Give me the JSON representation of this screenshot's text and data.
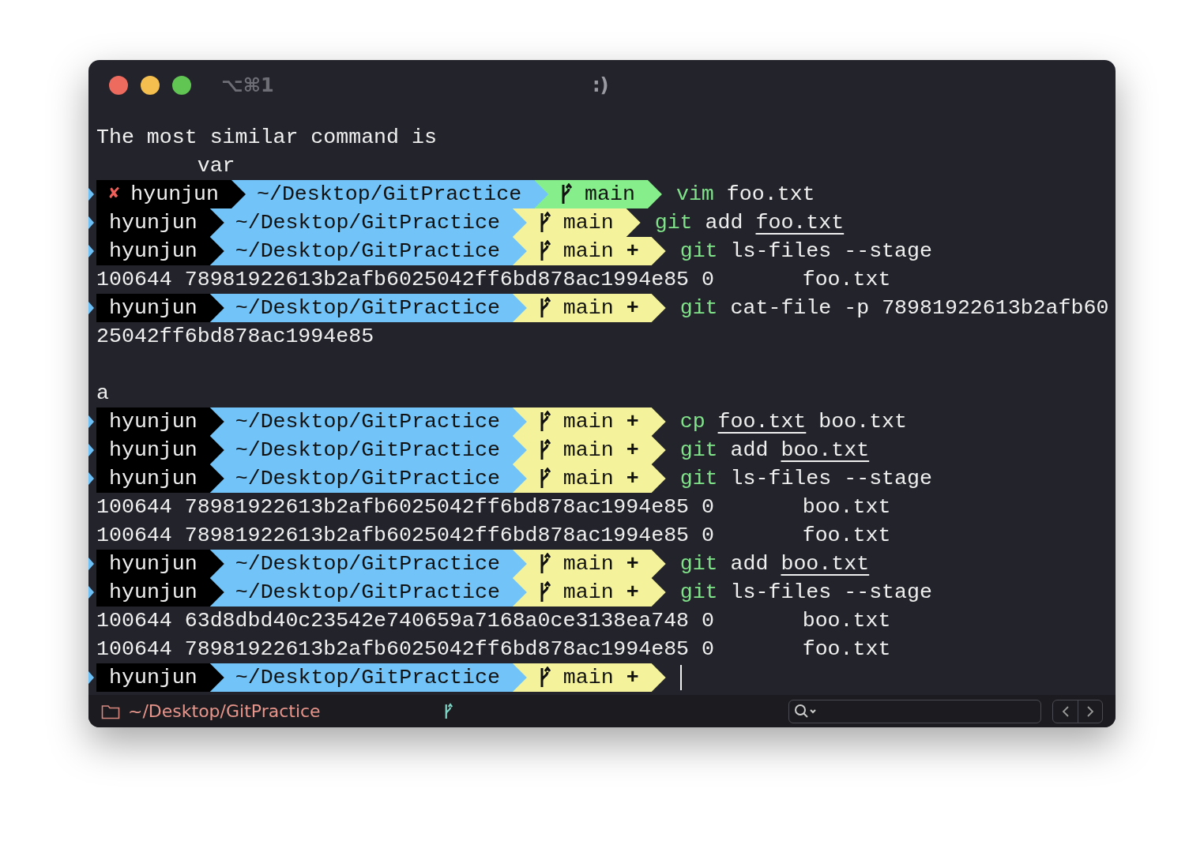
{
  "window": {
    "shortcut": "⌥⌘1",
    "title": ":)"
  },
  "lines": [
    {
      "kind": "output",
      "text": "The most similar command is"
    },
    {
      "kind": "output",
      "text": "        var"
    },
    {
      "kind": "prompt",
      "status_mark": "✘",
      "user": "hyunjun",
      "path": "~/Desktop/GitPractice",
      "branch": "main",
      "color": "#86ef8b",
      "command": [
        {
          "kind": "program",
          "text": "vim"
        },
        {
          "kind": "arg",
          "text": "foo.txt"
        }
      ]
    },
    {
      "kind": "prompt",
      "user": "hyunjun",
      "path": "~/Desktop/GitPractice",
      "branch": "main",
      "color": "#f4f39b",
      "command": [
        {
          "kind": "program",
          "text": "git"
        },
        {
          "kind": "arg",
          "text": "add"
        },
        {
          "kind": "path",
          "text": "foo.txt"
        }
      ]
    },
    {
      "kind": "prompt",
      "user": "hyunjun",
      "path": "~/Desktop/GitPractice",
      "branch": "main",
      "staged_mark": "+",
      "color": "#f4f39b",
      "command": [
        {
          "kind": "program",
          "text": "git"
        },
        {
          "kind": "arg",
          "text": "ls-files"
        },
        {
          "kind": "arg",
          "text": "--stage"
        }
      ]
    },
    {
      "kind": "output",
      "text": "100644 78981922613b2afb6025042ff6bd878ac1994e85 0       foo.txt"
    },
    {
      "kind": "prompt",
      "user": "hyunjun",
      "path": "~/Desktop/GitPractice",
      "branch": "main",
      "staged_mark": "+",
      "color": "#f4f39b",
      "command": [
        {
          "kind": "program",
          "text": "git"
        },
        {
          "kind": "arg",
          "text": "cat-file"
        },
        {
          "kind": "arg",
          "text": "-p"
        },
        {
          "kind": "arg",
          "text": "78981922613b2afb60"
        }
      ]
    },
    {
      "kind": "output",
      "text": "25042ff6bd878ac1994e85"
    },
    {
      "kind": "blank"
    },
    {
      "kind": "output",
      "text": "a"
    },
    {
      "kind": "prompt",
      "user": "hyunjun",
      "path": "~/Desktop/GitPractice",
      "branch": "main",
      "staged_mark": "+",
      "color": "#f4f39b",
      "command": [
        {
          "kind": "program",
          "text": "cp"
        },
        {
          "kind": "path",
          "text": "foo.txt"
        },
        {
          "kind": "arg",
          "text": "boo.txt"
        }
      ]
    },
    {
      "kind": "prompt",
      "user": "hyunjun",
      "path": "~/Desktop/GitPractice",
      "branch": "main",
      "staged_mark": "+",
      "color": "#f4f39b",
      "command": [
        {
          "kind": "program",
          "text": "git"
        },
        {
          "kind": "arg",
          "text": "add"
        },
        {
          "kind": "path",
          "text": "boo.txt"
        }
      ]
    },
    {
      "kind": "prompt",
      "user": "hyunjun",
      "path": "~/Desktop/GitPractice",
      "branch": "main",
      "staged_mark": "+",
      "color": "#f4f39b",
      "command": [
        {
          "kind": "program",
          "text": "git"
        },
        {
          "kind": "arg",
          "text": "ls-files"
        },
        {
          "kind": "arg",
          "text": "--stage"
        }
      ]
    },
    {
      "kind": "output",
      "text": "100644 78981922613b2afb6025042ff6bd878ac1994e85 0       boo.txt"
    },
    {
      "kind": "output",
      "text": "100644 78981922613b2afb6025042ff6bd878ac1994e85 0       foo.txt"
    },
    {
      "kind": "prompt",
      "user": "hyunjun",
      "path": "~/Desktop/GitPractice",
      "branch": "main",
      "staged_mark": "+",
      "color": "#f4f39b",
      "command": [
        {
          "kind": "program",
          "text": "git"
        },
        {
          "kind": "arg",
          "text": "add"
        },
        {
          "kind": "path",
          "text": "boo.txt"
        }
      ]
    },
    {
      "kind": "prompt",
      "user": "hyunjun",
      "path": "~/Desktop/GitPractice",
      "branch": "main",
      "staged_mark": "+",
      "color": "#f4f39b",
      "command": [
        {
          "kind": "program",
          "text": "git"
        },
        {
          "kind": "arg",
          "text": "ls-files"
        },
        {
          "kind": "arg",
          "text": "--stage"
        }
      ]
    },
    {
      "kind": "output",
      "text": "100644 63d8dbd40c23542e740659a7168a0ce3138ea748 0       boo.txt"
    },
    {
      "kind": "output",
      "text": "100644 78981922613b2afb6025042ff6bd878ac1994e85 0       foo.txt"
    },
    {
      "kind": "prompt",
      "user": "hyunjun",
      "path": "~/Desktop/GitPractice",
      "branch": "main",
      "staged_mark": "+",
      "color": "#f4f39b",
      "cursor": true
    }
  ],
  "status_bar": {
    "directory": "~/Desktop/GitPractice"
  }
}
